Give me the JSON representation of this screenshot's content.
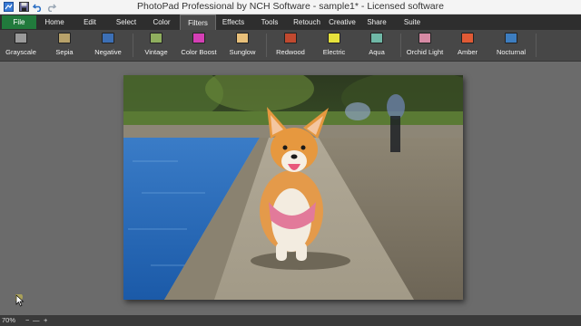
{
  "window": {
    "title": "PhotoPad Professional by NCH Software - sample1* - Licensed software"
  },
  "quick_access": [
    "app-icon",
    "save-icon",
    "undo-icon",
    "redo-icon"
  ],
  "menu": {
    "file": "File",
    "tabs": [
      "Home",
      "Edit",
      "Select",
      "Color",
      "Filters",
      "Effects",
      "Tools",
      "Retouch",
      "Creative",
      "Share",
      "Suite"
    ],
    "active_tab": "Filters"
  },
  "toolbar": {
    "tools": [
      {
        "label": "Grayscale",
        "icon": "grayscale-icon",
        "color": "#9a9a9a"
      },
      {
        "label": "Sepia",
        "icon": "sepia-icon",
        "color": "#b8a26a"
      },
      {
        "label": "Negative",
        "icon": "negative-icon",
        "color": "#3c6fb5"
      },
      {
        "label": "Vintage",
        "icon": "vintage-icon",
        "color": "#8fae5e"
      },
      {
        "label": "Color Boost",
        "icon": "color-boost-icon",
        "color": "#d43fb5"
      },
      {
        "label": "Sunglow",
        "icon": "sunglow-icon",
        "color": "#e8c07a"
      },
      {
        "label": "Redwood",
        "icon": "redwood-icon",
        "color": "#c0492f"
      },
      {
        "label": "Electric",
        "icon": "electric-icon",
        "color": "#e6e23c"
      },
      {
        "label": "Aqua",
        "icon": "aqua-icon",
        "color": "#6fb7a6"
      },
      {
        "label": "Orchid Light",
        "icon": "orchid-light-icon",
        "color": "#d68aa4"
      },
      {
        "label": "Amber",
        "icon": "amber-icon",
        "color": "#e05a35"
      },
      {
        "label": "Nocturnal",
        "icon": "nocturnal-icon",
        "color": "#3d7dbf"
      }
    ]
  },
  "canvas": {
    "image_subject": "corgi-photo"
  },
  "status": {
    "zoom": "70%",
    "zoom_out": "−",
    "zoom_sep": "—",
    "zoom_in": "+"
  },
  "colors": {
    "file_tab": "#217a3c",
    "menubar": "#2e2e2e",
    "toolbar": "#474747",
    "workspace": "#6b6b6b"
  }
}
